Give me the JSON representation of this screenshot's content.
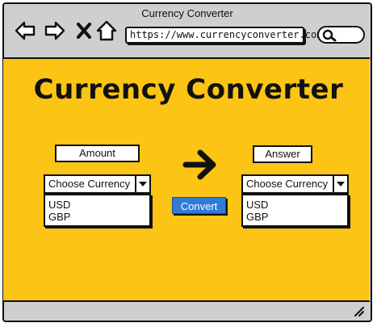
{
  "window": {
    "title": "Currency Converter"
  },
  "toolbar": {
    "url": "https://www.currencyconverter.com",
    "icons": [
      "back-arrow-icon",
      "forward-arrow-icon",
      "close-icon",
      "home-icon",
      "search-icon"
    ]
  },
  "page": {
    "headline": "Currency Converter",
    "amount_label": "Amount",
    "answer_label": "Answer",
    "from_select": {
      "value": "Choose Currency",
      "options": [
        "USD",
        "GBP"
      ]
    },
    "to_select": {
      "value": "Choose Currency",
      "options": [
        "USD",
        "GBP"
      ]
    },
    "convert_label": "Convert"
  },
  "colors": {
    "background": "#fcc414",
    "accent": "#2f7bd6",
    "chrome": "#cfcfcf"
  }
}
